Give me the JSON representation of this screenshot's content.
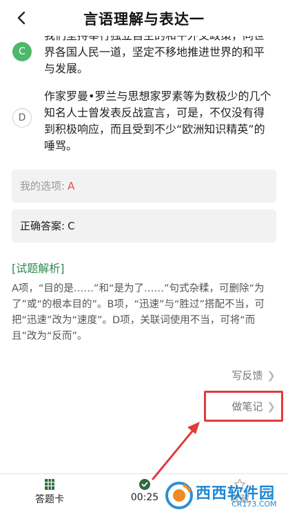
{
  "header": {
    "title": "言语理解与表达一"
  },
  "options": [
    {
      "letter": "C",
      "text": "我们坚持奉行独立自主的和平外交政策，同世界各国人民一道，坚定不移地推进世界的和平与发展。",
      "state": "correct"
    },
    {
      "letter": "D",
      "text": "作家罗曼•罗兰与思想家罗素等为数极少的几个知名人士曾发表反战宣言，可是，不仅没有得到积极响应，而且受到不少“欧洲知识精英”的唾骂。",
      "state": "normal"
    }
  ],
  "answers": {
    "my_label": "我的选项:",
    "my_value": "A",
    "correct_label": "正确答案:",
    "correct_value": "C"
  },
  "analysis": {
    "title": "[试题解析]",
    "text": "A项，“目的是……”和“是为了……”句式杂糅，可删除“为了”或“的根本目的”。B项，“迅速”与“胜过”搭配不当，可把“迅速”改为“速度”。D项，关联词使用不当，可将“而且”改为“反而”。"
  },
  "actions": {
    "feedback": "写反馈",
    "notes": "做笔记"
  },
  "bottom": {
    "card": "答题卡",
    "timer": "00:25",
    "favorite": "收藏"
  },
  "watermark": {
    "brand": "西西软件园",
    "domain": "CR173.COM"
  },
  "colors": {
    "correct_green": "#4cb86a",
    "analysis_green": "#2d8a4e",
    "wrong_red": "#e84b4b",
    "highlight_red": "#e03a3a"
  },
  "icons": {
    "back": "chevron-left-icon",
    "card": "grid-card-icon",
    "timer": "clock-icon",
    "more": "chevron-right-icon"
  }
}
